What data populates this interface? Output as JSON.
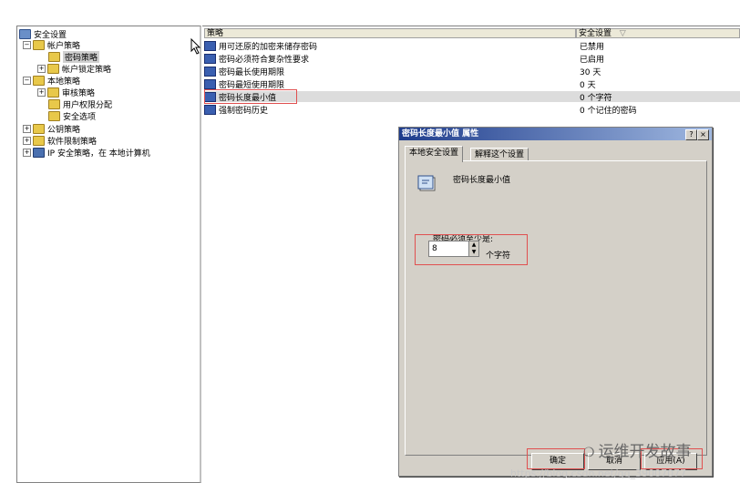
{
  "tree": {
    "root": "安全设置",
    "account_policies": "帐户策略",
    "password_policy": "密码策略",
    "lockout_policy": "帐户锁定策略",
    "local_policies": "本地策略",
    "audit_policy": "审核策略",
    "user_rights": "用户权限分配",
    "security_options": "安全选项",
    "public_key": "公钥策略",
    "software_restriction": "软件限制策略",
    "ip_security": "IP 安全策略，在 本地计算机"
  },
  "list": {
    "header_policy": "策略",
    "header_setting": "安全设置",
    "rows": [
      {
        "policy": "用可还原的加密来储存密码",
        "value": "已禁用"
      },
      {
        "policy": "密码必须符合复杂性要求",
        "value": "已启用"
      },
      {
        "policy": "密码最长使用期限",
        "value": "30 天"
      },
      {
        "policy": "密码最短使用期限",
        "value": "0 天"
      },
      {
        "policy": "密码长度最小值",
        "value": "0 个字符"
      },
      {
        "policy": "强制密码历史",
        "value": "0 个记住的密码"
      }
    ]
  },
  "dialog": {
    "title": "密码长度最小值 属性",
    "help": "?",
    "close": "×",
    "tab_local": "本地安全设置",
    "tab_explain": "解释这个设置",
    "policy_name": "密码长度最小值",
    "prompt": "密码必须至少是:",
    "value": "8",
    "unit": "个字符",
    "ok": "确定",
    "cancel": "取消",
    "apply": "应用(A)"
  },
  "watermark": {
    "text": "运维开发故事",
    "url": "https://blog.csdn.net/qq_39007077"
  }
}
